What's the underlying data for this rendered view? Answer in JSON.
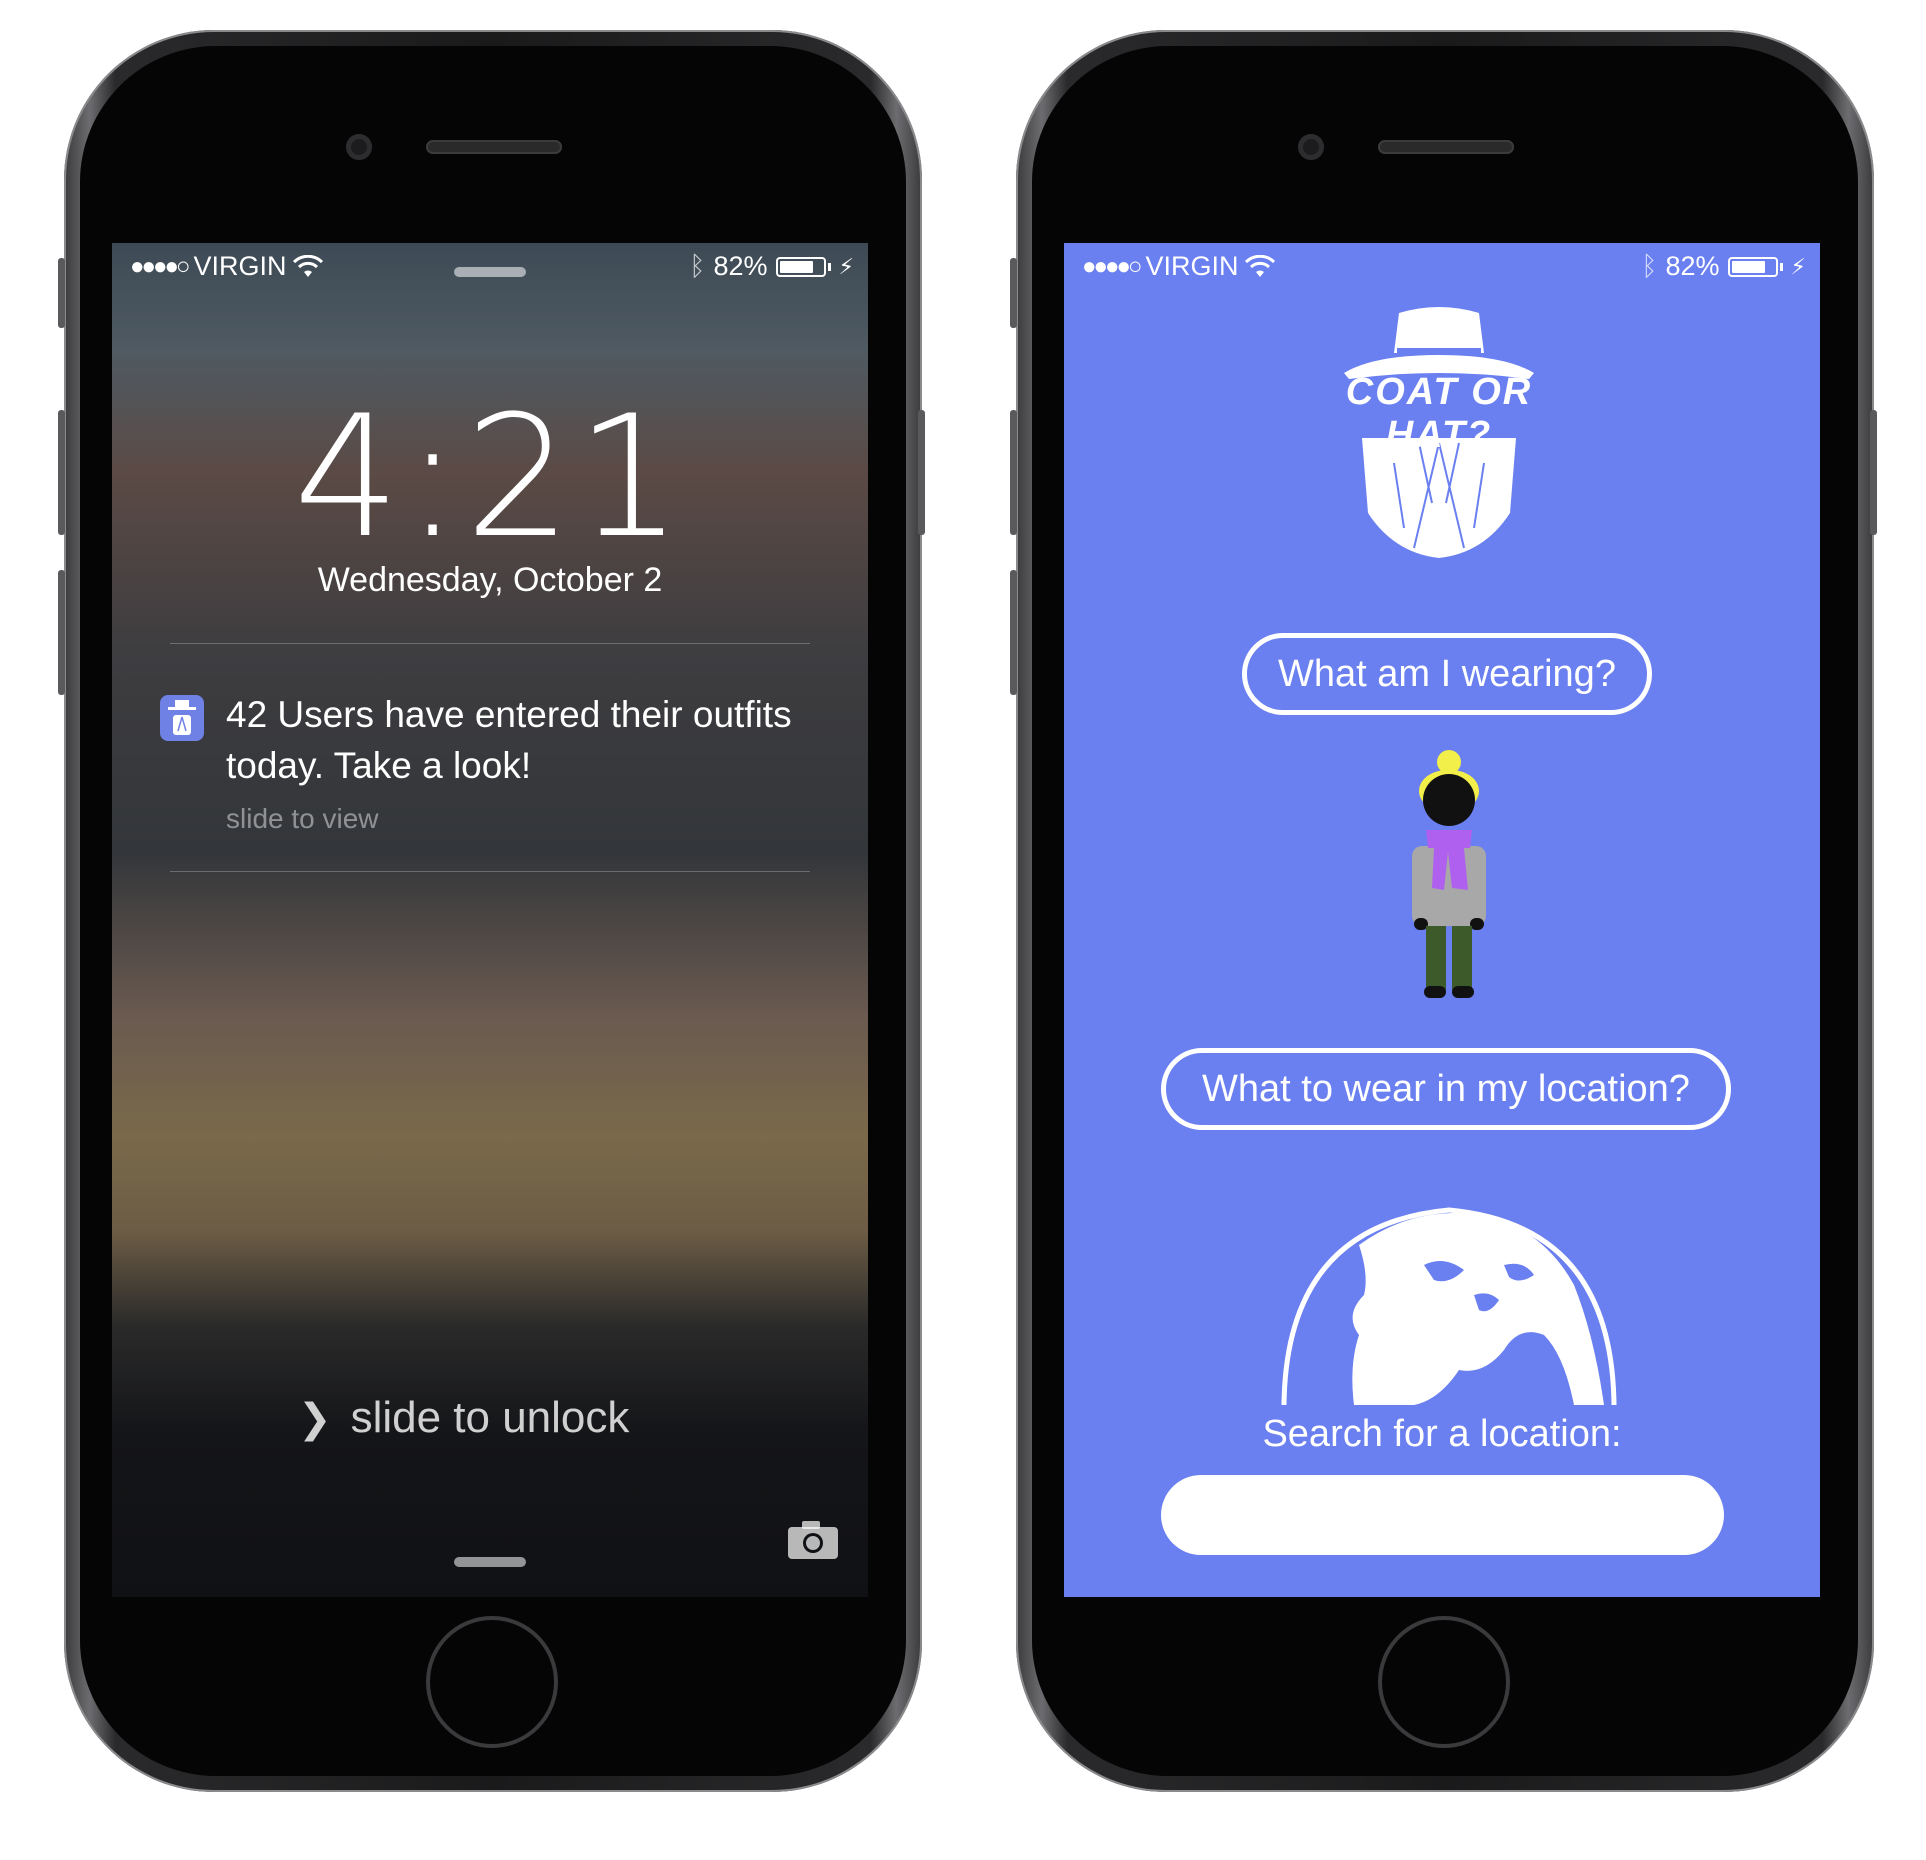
{
  "status_bar": {
    "carrier": "VIRGIN",
    "signal": "●●●●○",
    "battery_percent": "82%",
    "battery_level": 0.82
  },
  "lock_screen": {
    "time": "4:21",
    "date": "Wednesday, October 2",
    "notification": {
      "message": "42 Users have entered their outfits today. Take a look!",
      "action_hint": "slide to view"
    },
    "unlock_text": "slide to unlock"
  },
  "app": {
    "logo_text": "COAT OR HAT?",
    "what_am_i_wearing_label": "What am I wearing?",
    "what_to_wear_label": "What to wear in my location?",
    "search_label": "Search for a location:",
    "search_value": "",
    "colors": {
      "background": "#6a7ff0",
      "hat": "#f2ee4a",
      "scarf": "#b060ee",
      "coat": "#a8a8a8",
      "pants": "#3d5a2a"
    }
  }
}
